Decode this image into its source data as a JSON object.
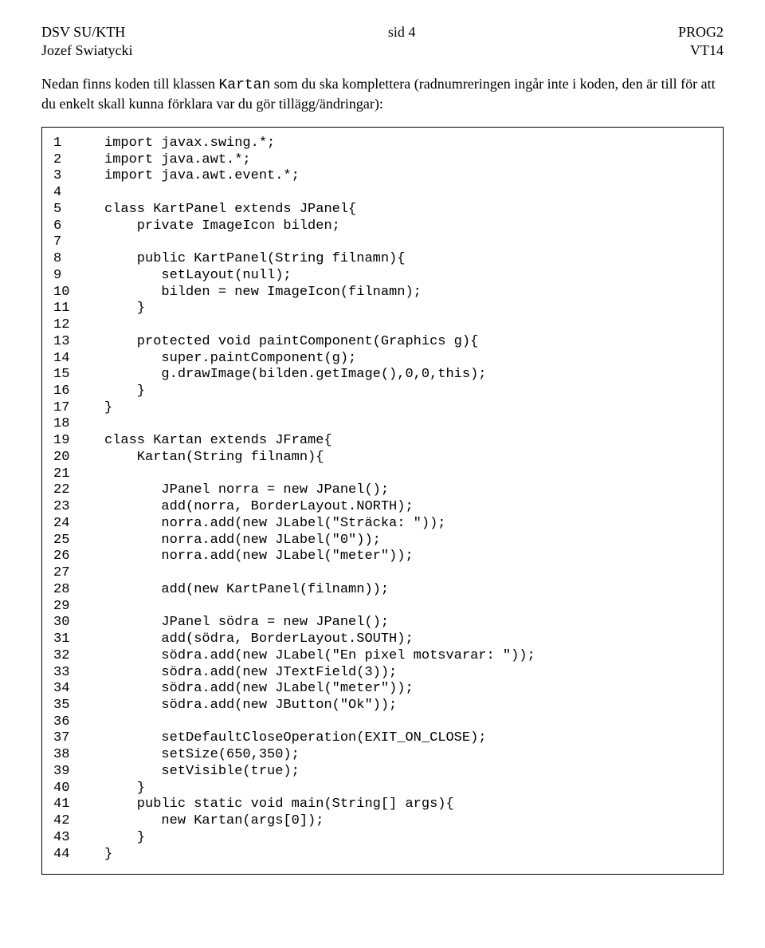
{
  "header": {
    "left": "DSV SU/KTH",
    "center": "sid 4",
    "right": "PROG2"
  },
  "subheader": {
    "left": "Jozef Swiatycki",
    "right": "VT14"
  },
  "intro": "Nedan finns koden till klassen Kartan som du ska komplettera (radnumreringen ingår inte i koden, den är till för att du enkelt skall kunna förklara var du gör tillägg/ändringar):",
  "code": [
    {
      "n": "1",
      "t": "import javax.swing.*;"
    },
    {
      "n": "2",
      "t": "import java.awt.*;"
    },
    {
      "n": "3",
      "t": "import java.awt.event.*;"
    },
    {
      "n": "4",
      "t": ""
    },
    {
      "n": "5",
      "t": "class KartPanel extends JPanel{"
    },
    {
      "n": "6",
      "t": "    private ImageIcon bilden;"
    },
    {
      "n": "7",
      "t": ""
    },
    {
      "n": "8",
      "t": "    public KartPanel(String filnamn){"
    },
    {
      "n": "9",
      "t": "       setLayout(null);"
    },
    {
      "n": "10",
      "t": "       bilden = new ImageIcon(filnamn);"
    },
    {
      "n": "11",
      "t": "    }"
    },
    {
      "n": "12",
      "t": ""
    },
    {
      "n": "13",
      "t": "    protected void paintComponent(Graphics g){"
    },
    {
      "n": "14",
      "t": "       super.paintComponent(g);"
    },
    {
      "n": "15",
      "t": "       g.drawImage(bilden.getImage(),0,0,this);"
    },
    {
      "n": "16",
      "t": "    }"
    },
    {
      "n": "17",
      "t": "}"
    },
    {
      "n": "18",
      "t": ""
    },
    {
      "n": "19",
      "t": "class Kartan extends JFrame{"
    },
    {
      "n": "20",
      "t": "    Kartan(String filnamn){"
    },
    {
      "n": "21",
      "t": ""
    },
    {
      "n": "22",
      "t": "       JPanel norra = new JPanel();"
    },
    {
      "n": "23",
      "t": "       add(norra, BorderLayout.NORTH);"
    },
    {
      "n": "24",
      "t": "       norra.add(new JLabel(\"Sträcka: \"));"
    },
    {
      "n": "25",
      "t": "       norra.add(new JLabel(\"0\"));"
    },
    {
      "n": "26",
      "t": "       norra.add(new JLabel(\"meter\"));"
    },
    {
      "n": "27",
      "t": ""
    },
    {
      "n": "28",
      "t": "       add(new KartPanel(filnamn));"
    },
    {
      "n": "29",
      "t": ""
    },
    {
      "n": "30",
      "t": "       JPanel södra = new JPanel();"
    },
    {
      "n": "31",
      "t": "       add(södra, BorderLayout.SOUTH);"
    },
    {
      "n": "32",
      "t": "       södra.add(new JLabel(\"En pixel motsvarar: \"));"
    },
    {
      "n": "33",
      "t": "       södra.add(new JTextField(3));"
    },
    {
      "n": "34",
      "t": "       södra.add(new JLabel(\"meter\"));"
    },
    {
      "n": "35",
      "t": "       södra.add(new JButton(\"Ok\"));"
    },
    {
      "n": "36",
      "t": ""
    },
    {
      "n": "37",
      "t": "       setDefaultCloseOperation(EXIT_ON_CLOSE);"
    },
    {
      "n": "38",
      "t": "       setSize(650,350);"
    },
    {
      "n": "39",
      "t": "       setVisible(true);"
    },
    {
      "n": "40",
      "t": "    }"
    },
    {
      "n": "41",
      "t": "    public static void main(String[] args){"
    },
    {
      "n": "42",
      "t": "       new Kartan(args[0]);"
    },
    {
      "n": "43",
      "t": "    }"
    },
    {
      "n": "44",
      "t": "}"
    }
  ]
}
